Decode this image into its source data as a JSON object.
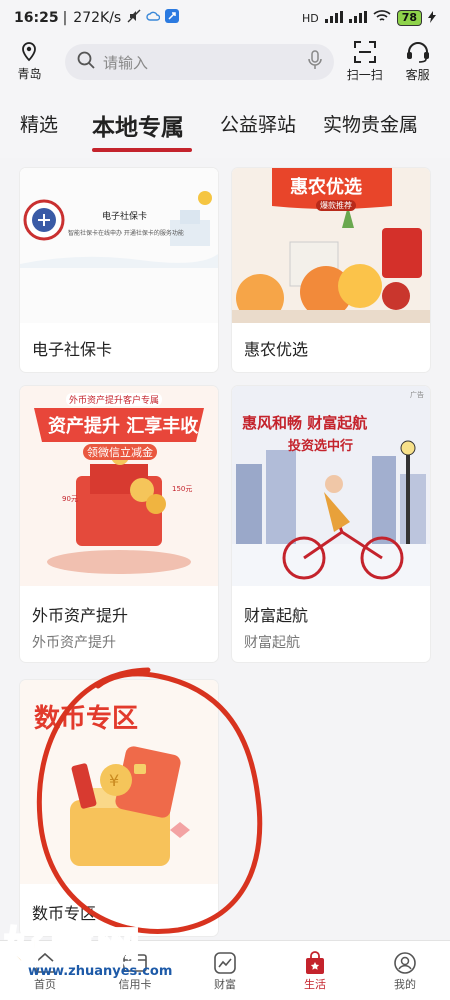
{
  "status_bar": {
    "time": "16:25",
    "speed": "272K/s",
    "battery": "78",
    "network": "HD"
  },
  "header": {
    "location": "青岛",
    "search_placeholder": "请输入",
    "scan_label": "扫一扫",
    "service_label": "客服"
  },
  "tabs": [
    {
      "label": "精选"
    },
    {
      "label": "本地专属"
    },
    {
      "label": "公益驿站"
    },
    {
      "label": "实物贵金属"
    }
  ],
  "cards": [
    {
      "title": "电子社保卡",
      "subtitle": "",
      "image_caption": "电子社保卡",
      "image_note": "智能社保卡在线申办 开通社保卡的服务功能"
    },
    {
      "title": "惠农优选",
      "subtitle": "",
      "image_caption": "惠农优选",
      "image_badge": "爆款推荐"
    },
    {
      "title": "外币资产提升",
      "subtitle": "外币资产提升",
      "image_caption": "资产提升 汇享丰收",
      "image_top": "外币资产提升客户专属",
      "image_coupon": "领微信立减金",
      "amount_1": "90元",
      "amount_2": "150元"
    },
    {
      "title": "财富起航",
      "subtitle": "财富起航",
      "image_caption": "惠风和畅 财富起航",
      "image_sub": "投资选中行",
      "ad_tag": "广告"
    },
    {
      "title": "数币专区",
      "subtitle": "",
      "image_caption": "数币专区"
    }
  ],
  "bottom_nav": [
    {
      "label": "首页",
      "icon": "home-icon"
    },
    {
      "label": "信用卡",
      "icon": "credit-card-icon"
    },
    {
      "label": "财富",
      "icon": "wealth-icon"
    },
    {
      "label": "生活",
      "icon": "life-bag-icon",
      "active": true
    },
    {
      "label": "我的",
      "icon": "user-icon"
    }
  ],
  "watermark": {
    "text": "好赚网",
    "url": "www.zhuanyes.com"
  },
  "colors": {
    "accent": "#c4232c",
    "bg": "#f4f4f6"
  }
}
